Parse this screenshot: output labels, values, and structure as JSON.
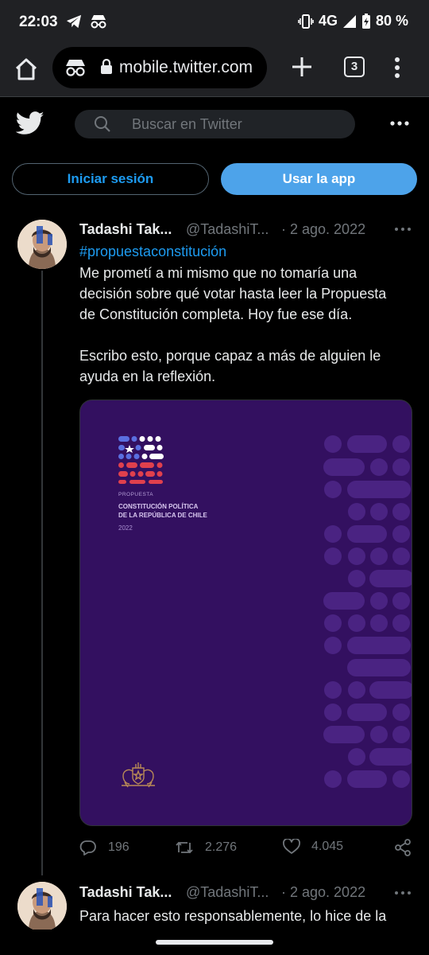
{
  "status_bar": {
    "time": "22:03",
    "network": "4G",
    "battery": "80 %",
    "icons": [
      "telegram-icon",
      "incognito-icon",
      "vibrate-icon",
      "signal-icon",
      "battery-charging-icon"
    ]
  },
  "browser": {
    "url": "mobile.twitter.com",
    "tab_count": "3",
    "icons": [
      "home-icon",
      "incognito-icon",
      "lock-icon",
      "new-tab-icon",
      "tabs-icon",
      "menu-icon"
    ]
  },
  "twitter": {
    "search_placeholder": "Buscar en Twitter",
    "login_label": "Iniciar sesión",
    "app_label": "Usar la app",
    "accent": "#1d9bf0"
  },
  "tweets": [
    {
      "name": "Tadashi Tak...",
      "handle": "@TadashiT...",
      "date": "· 2 ago. 2022",
      "hashtag": "#propuestaconstitución",
      "text_lines": [
        "Me prometí a mi mismo que no tomaría una",
        "decisión sobre qué votar hasta leer la Propuesta",
        "de Constitución completa. Hoy fue ese día."
      ],
      "text_lines_2": [
        "Escribo esto, porque capaz a más de alguien le",
        "ayuda en la reflexión."
      ],
      "media": {
        "cover_label": "PROPUESTA",
        "cover_title_1": "CONSTITUCIÓN POLÍTICA",
        "cover_title_2": "DE LA REPÚBLICA DE CHILE",
        "cover_year": "2022",
        "background": "#331060"
      },
      "replies": "196",
      "retweets": "2.276",
      "likes": "4.045"
    },
    {
      "name": "Tadashi Tak...",
      "handle": "@TadashiT...",
      "date": "· 2 ago. 2022",
      "text_lines": [
        "Para hacer esto responsablemente, lo hice de la"
      ]
    }
  ]
}
